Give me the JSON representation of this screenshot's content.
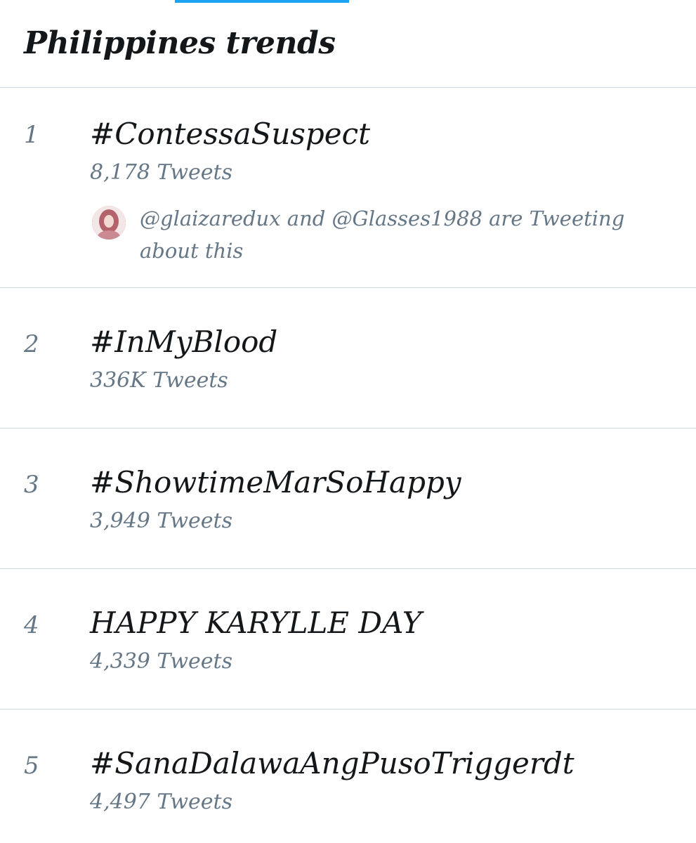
{
  "header": {
    "title": "Philippines trends",
    "accent_color": "#1da1f2"
  },
  "trends": [
    {
      "rank": "1",
      "name": "#ContessaSuspect",
      "count": "8,178 Tweets",
      "context": "@glaizaredux and @Glasses1988 are Tweeting about this",
      "context_avatar_icon": "user-avatar"
    },
    {
      "rank": "2",
      "name": "#InMyBlood",
      "count": "336K Tweets"
    },
    {
      "rank": "3",
      "name": "#ShowtimeMarSoHappy",
      "count": "3,949 Tweets"
    },
    {
      "rank": "4",
      "name": "HAPPY KARYLLE DAY",
      "count": "4,339 Tweets"
    },
    {
      "rank": "5",
      "name": "#SanaDalawaAngPusoTriggerdt",
      "count": "4,497 Tweets"
    }
  ]
}
